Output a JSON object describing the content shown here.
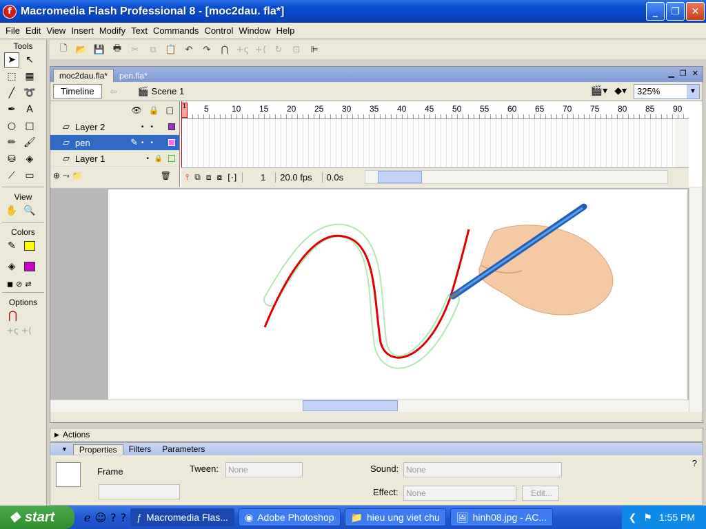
{
  "window": {
    "title": "Macromedia Flash Professional 8 - [moc2dau. fla*]"
  },
  "menu": [
    "File",
    "Edit",
    "View",
    "Insert",
    "Modify",
    "Text",
    "Commands",
    "Control",
    "Window",
    "Help"
  ],
  "tools_panel": {
    "title": "Tools",
    "view_title": "View",
    "colors_title": "Colors",
    "options_title": "Options",
    "stroke_color": "#ffff00",
    "fill_color": "#cc00cc"
  },
  "document": {
    "tabs": [
      "moc2dau.fla*",
      "pen.fla*"
    ],
    "timeline_button": "Timeline",
    "scene": "Scene 1",
    "zoom": "325%"
  },
  "timeline": {
    "ruler_marks": [
      "1",
      "5",
      "10",
      "15",
      "20",
      "25",
      "30",
      "35",
      "40",
      "45",
      "50",
      "55",
      "60",
      "65",
      "70",
      "75",
      "80",
      "85",
      "90"
    ],
    "layers": [
      {
        "name": "Layer 2",
        "selected": false,
        "color": "#9933cc"
      },
      {
        "name": "pen",
        "selected": true,
        "color": "#ff66ff"
      },
      {
        "name": "Layer 1",
        "selected": false,
        "color": "#33cc33"
      }
    ],
    "current_frame": "1",
    "fps": "20.0 fps",
    "elapsed": "0.0s"
  },
  "panels": {
    "actions": "Actions",
    "tabs": [
      "Properties",
      "Filters",
      "Parameters"
    ],
    "frame_label": "Frame",
    "tween_label": "Tween:",
    "tween_value": "None",
    "sound_label": "Sound:",
    "sound_value": "None",
    "effect_label": "Effect:",
    "effect_value": "None",
    "edit_button": "Edit..."
  },
  "taskbar": {
    "start": "start",
    "tasks": [
      "Macromedia Flas...",
      "Adobe Photoshop",
      "hieu ung viet chu",
      "hinh08.jpg - AC..."
    ],
    "clock": "1:55 PM"
  }
}
